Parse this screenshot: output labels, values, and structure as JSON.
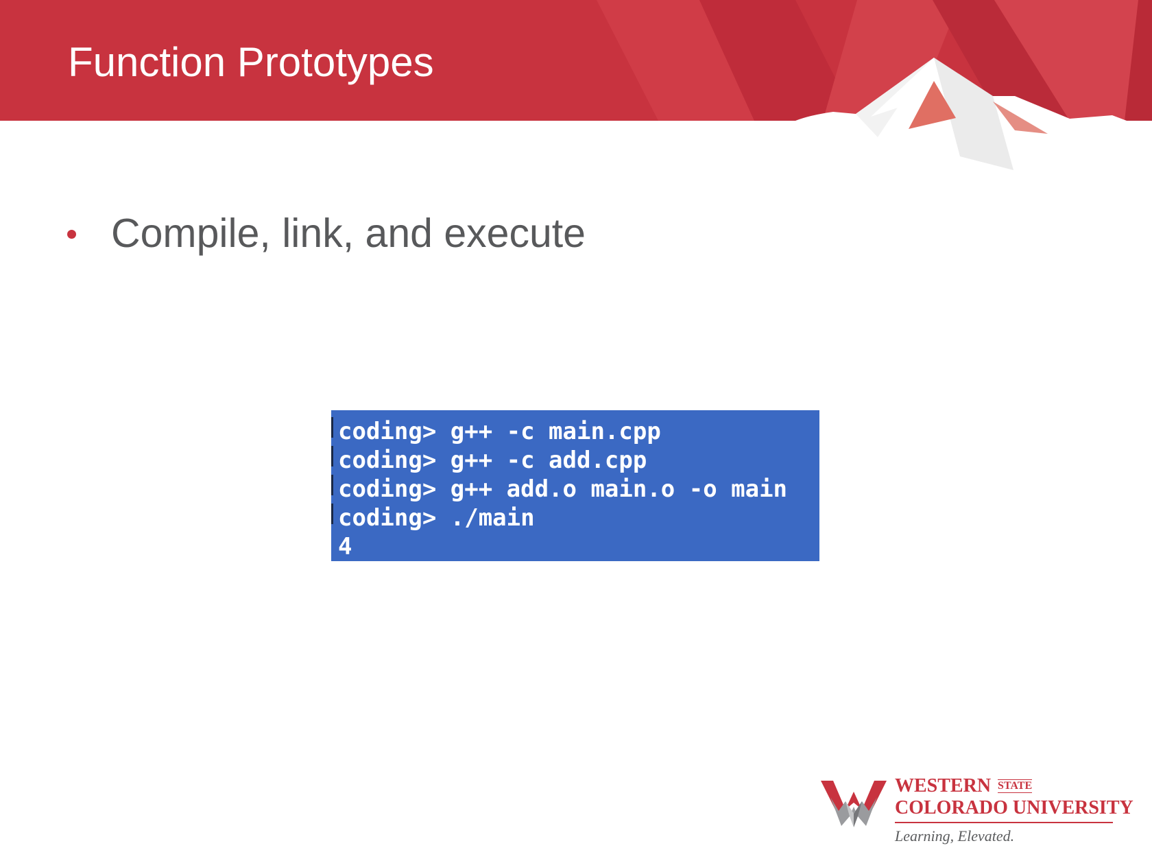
{
  "slide": {
    "title": "Function Prototypes",
    "bullets": [
      {
        "text": "Compile, link, and execute"
      }
    ]
  },
  "terminal": {
    "lines": [
      "coding> g++ -c main.cpp",
      "coding> g++ -c add.cpp",
      "coding> g++ add.o main.o -o main",
      "coding> ./main",
      "4"
    ]
  },
  "logo": {
    "word1": "WESTERN",
    "state": "STATE",
    "word2": "COLORADO UNIVERSITY",
    "tagline": "Learning, Elevated."
  },
  "colors": {
    "brand_red": "#c8333f",
    "terminal_blue": "#3b69c3",
    "bullet_text": "#58595b"
  }
}
